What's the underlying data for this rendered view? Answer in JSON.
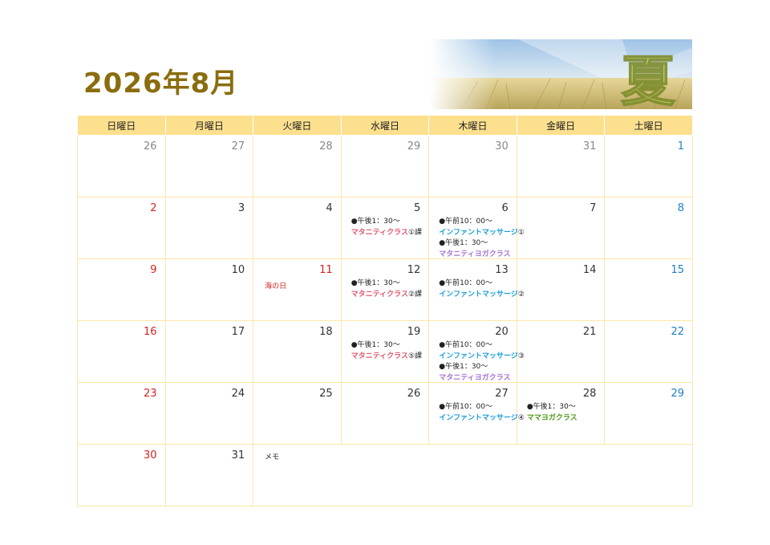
{
  "title": "2026年8月",
  "banner": {
    "kanji": "夏"
  },
  "weekdays": [
    "日曜日",
    "月曜日",
    "火曜日",
    "水曜日",
    "木曜日",
    "金曜日",
    "土曜日"
  ],
  "weeks": [
    [
      "26",
      "27",
      "28",
      "29",
      "30",
      "31",
      "1"
    ],
    [
      "2",
      "3",
      "4",
      "5",
      "6",
      "7",
      "8"
    ],
    [
      "9",
      "10",
      "11",
      "12",
      "13",
      "14",
      "15"
    ],
    [
      "16",
      "17",
      "18",
      "19",
      "20",
      "21",
      "22"
    ],
    [
      "23",
      "24",
      "25",
      "26",
      "27",
      "28",
      "29"
    ],
    [
      "30",
      "31"
    ]
  ],
  "holiday": "海の日",
  "memo_label": "メモ",
  "events": {
    "time_pm": "●午後1：30～",
    "time_am": "●午前10：00～",
    "maternity": "マタニティクラス",
    "infant": "インファントマッサージ",
    "yoga": "マタニティヨガクラス",
    "mama": "ママヨガクラス",
    "w_aug5_suffix": "①課",
    "w_aug12_suffix": "②課",
    "w_aug19_suffix": "⑤課",
    "aug6_suffix": "①",
    "aug13_suffix": "②",
    "aug20_suffix": "③",
    "aug27_suffix": "④"
  }
}
